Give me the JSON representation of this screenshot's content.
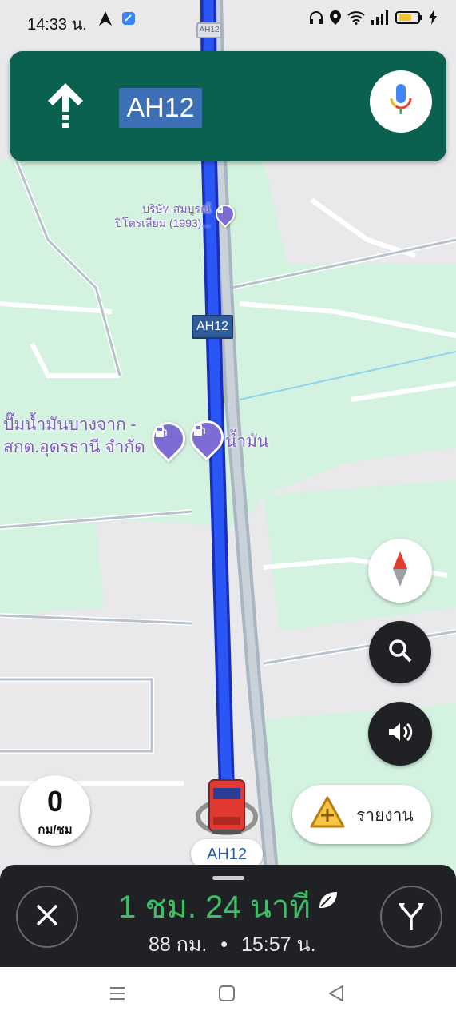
{
  "status_bar": {
    "time": "14:33 น.",
    "icons": [
      "navigation-arrow-icon",
      "app-notification-icon",
      "headphones-icon",
      "location-icon",
      "wifi-icon",
      "signal-icon",
      "battery-icon",
      "charging-icon"
    ]
  },
  "navigation": {
    "direction_icon": "straight-arrow-icon",
    "road_name": "AH12",
    "mic_icon": "microphone-icon"
  },
  "map": {
    "top_road_label": "AH12",
    "poi_1": {
      "line1": "บริษัท สมบูรณ์",
      "line2": "ปิโตรเลียม (1993)..."
    },
    "route_shield": "AH12",
    "poi_2": {
      "line1": "ปั๊มน้ำมันบางจาก -",
      "line2": "สกต.อุดรธานี จำกัด"
    },
    "poi_3": "น้ำมัน",
    "current_road": "AH12"
  },
  "controls": {
    "compass_icon": "compass-icon",
    "search_icon": "search-icon",
    "sound_icon": "volume-icon",
    "speed_value": "0",
    "speed_unit": "กม/ชม",
    "report_label": "รายงาน"
  },
  "trip": {
    "eta_duration": "1 ชม. 24 นาที",
    "distance": "88 กม.",
    "separator": "•",
    "arrival": "15:57 น."
  },
  "colors": {
    "nav_green": "#0b6150",
    "route_blue": "#1a3df2",
    "eta_green": "#3dbd66",
    "poi_purple": "#7c6cd3"
  }
}
